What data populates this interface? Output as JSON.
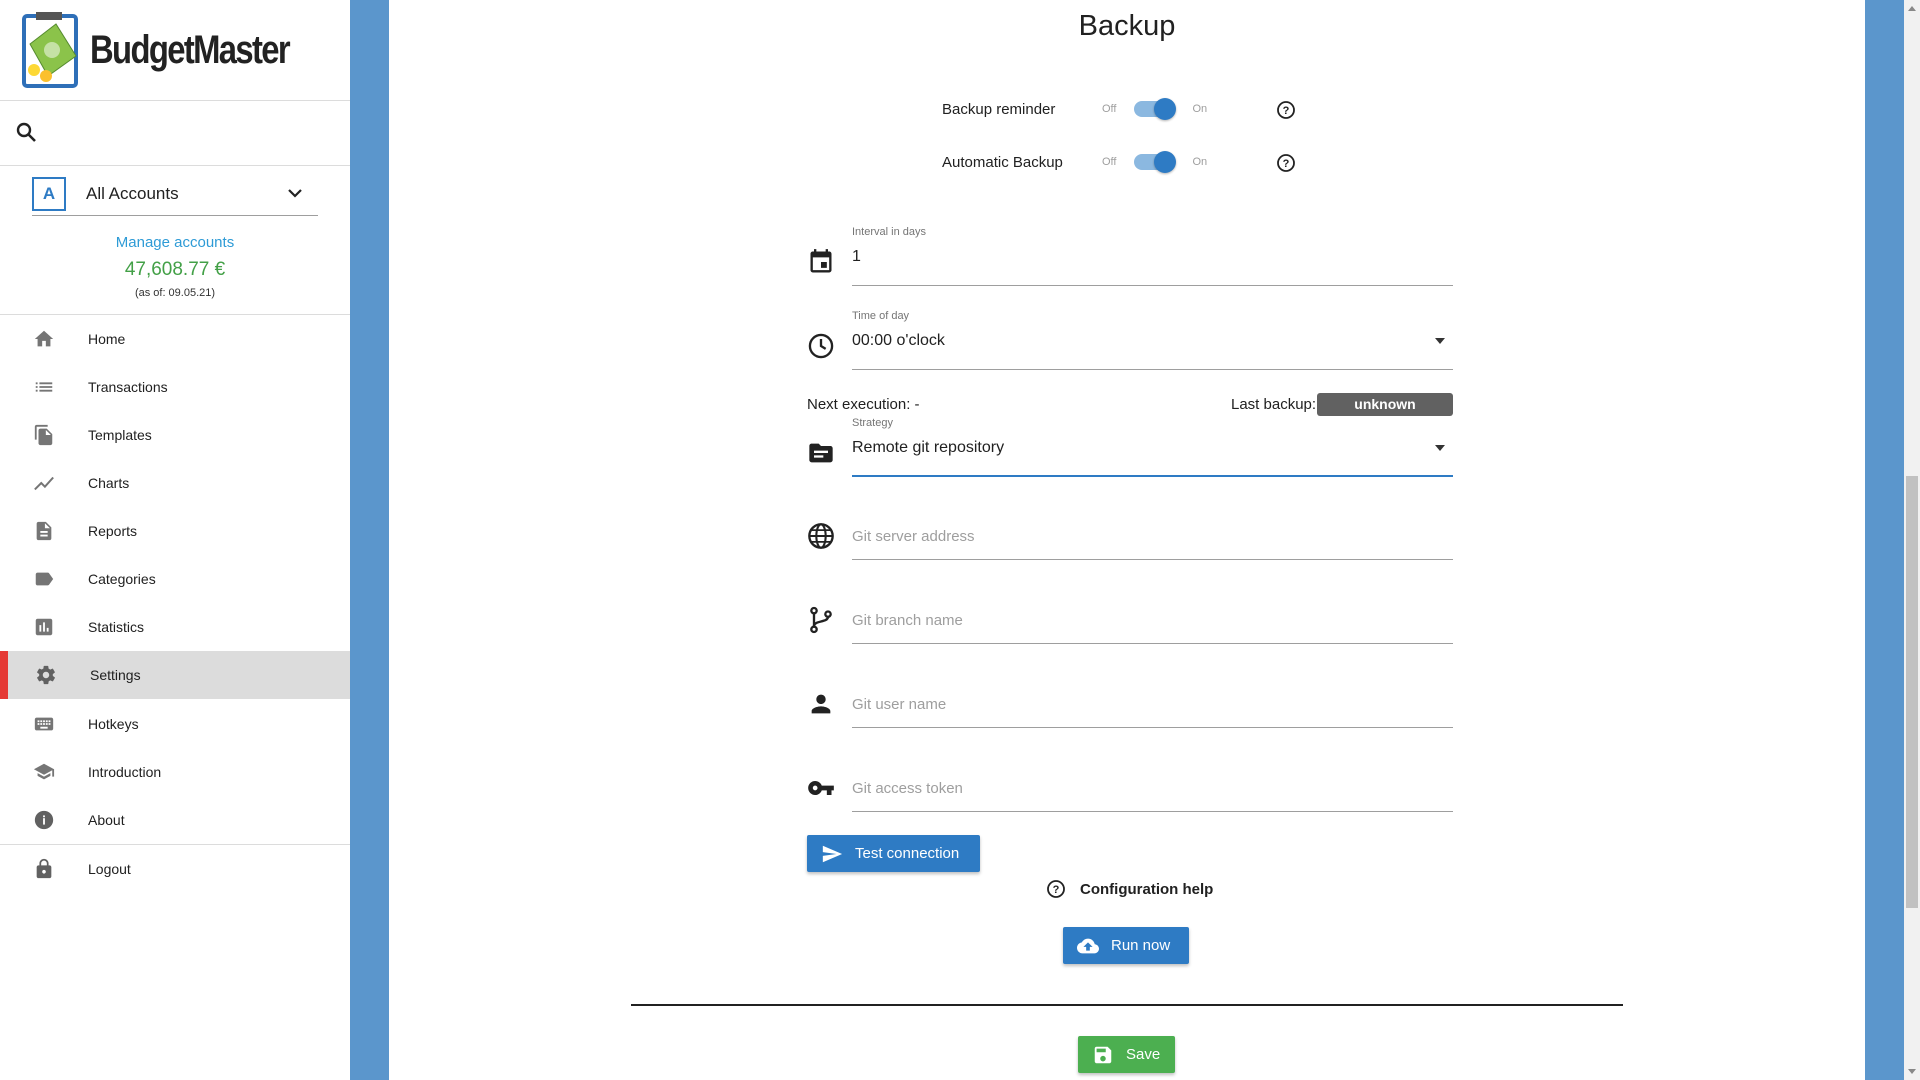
{
  "app": {
    "name": "BudgetMaster"
  },
  "sidebar": {
    "account": {
      "badge": "A",
      "name": "All Accounts"
    },
    "manage_accounts": "Manage accounts",
    "balance": "47,608.77 €",
    "as_of": "(as of: 09.05.21)",
    "items": [
      {
        "label": "Home",
        "icon": "home-icon"
      },
      {
        "label": "Transactions",
        "icon": "list-icon"
      },
      {
        "label": "Templates",
        "icon": "file-copy-icon"
      },
      {
        "label": "Charts",
        "icon": "line-chart-icon"
      },
      {
        "label": "Reports",
        "icon": "document-icon"
      },
      {
        "label": "Categories",
        "icon": "label-icon"
      },
      {
        "label": "Statistics",
        "icon": "bar-chart-icon"
      },
      {
        "label": "Settings",
        "icon": "gear-icon",
        "active": true
      },
      {
        "label": "Hotkeys",
        "icon": "keyboard-icon"
      },
      {
        "label": "Introduction",
        "icon": "school-icon"
      },
      {
        "label": "About",
        "icon": "info-icon"
      },
      {
        "label": "Logout",
        "icon": "lock-icon"
      }
    ]
  },
  "main": {
    "title": "Backup",
    "backup_reminder": {
      "label": "Backup reminder",
      "off": "Off",
      "on": "On",
      "value": true
    },
    "automatic_backup": {
      "label": "Automatic Backup",
      "off": "Off",
      "on": "On",
      "value": true
    },
    "interval": {
      "label": "Interval in days",
      "value": "1"
    },
    "time_of_day": {
      "label": "Time of day",
      "value": "00:00 o'clock"
    },
    "next_execution": "Next execution: -",
    "last_backup_label": "Last backup:",
    "last_backup_value": "unknown",
    "strategy": {
      "label": "Strategy",
      "value": "Remote git repository"
    },
    "git_server": {
      "placeholder": "Git server address"
    },
    "git_branch": {
      "placeholder": "Git branch name"
    },
    "git_user": {
      "placeholder": "Git user name"
    },
    "git_token": {
      "placeholder": "Git access token"
    },
    "test_connection": "Test connection",
    "config_help": "Configuration help",
    "run_now": "Run now",
    "save": "Save"
  },
  "colors": {
    "accent": "#2e7bc4",
    "background": "#5b96cc",
    "active_marker": "#e53935",
    "balance": "#43a047",
    "save": "#4caf50"
  }
}
